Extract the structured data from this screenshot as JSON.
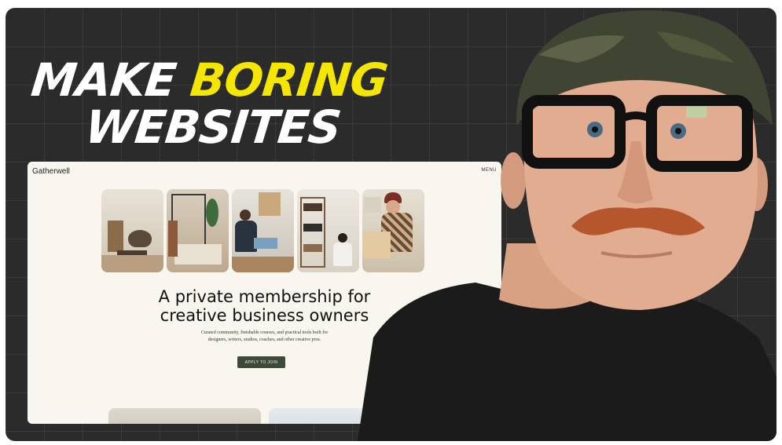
{
  "headline": {
    "word1": "MAKE",
    "word2": "BORING",
    "word3": "WEBSITES",
    "accent_color": "#f5e600"
  },
  "site": {
    "logo": "Gatherwell",
    "menu": "MENU",
    "title_line1": "A private membership for",
    "title_line2": "creative business owners",
    "subtitle_line1": "Curated community, finishable courses, and practical tools built for",
    "subtitle_line2": "designers, writers, studios, coaches, and other creative pros.",
    "cta": "APPLY TO JOIN",
    "cta_color": "#3d4a3a",
    "background": "#f8f6ee"
  },
  "icons": [
    "photo-workspace",
    "presenter-photo"
  ]
}
